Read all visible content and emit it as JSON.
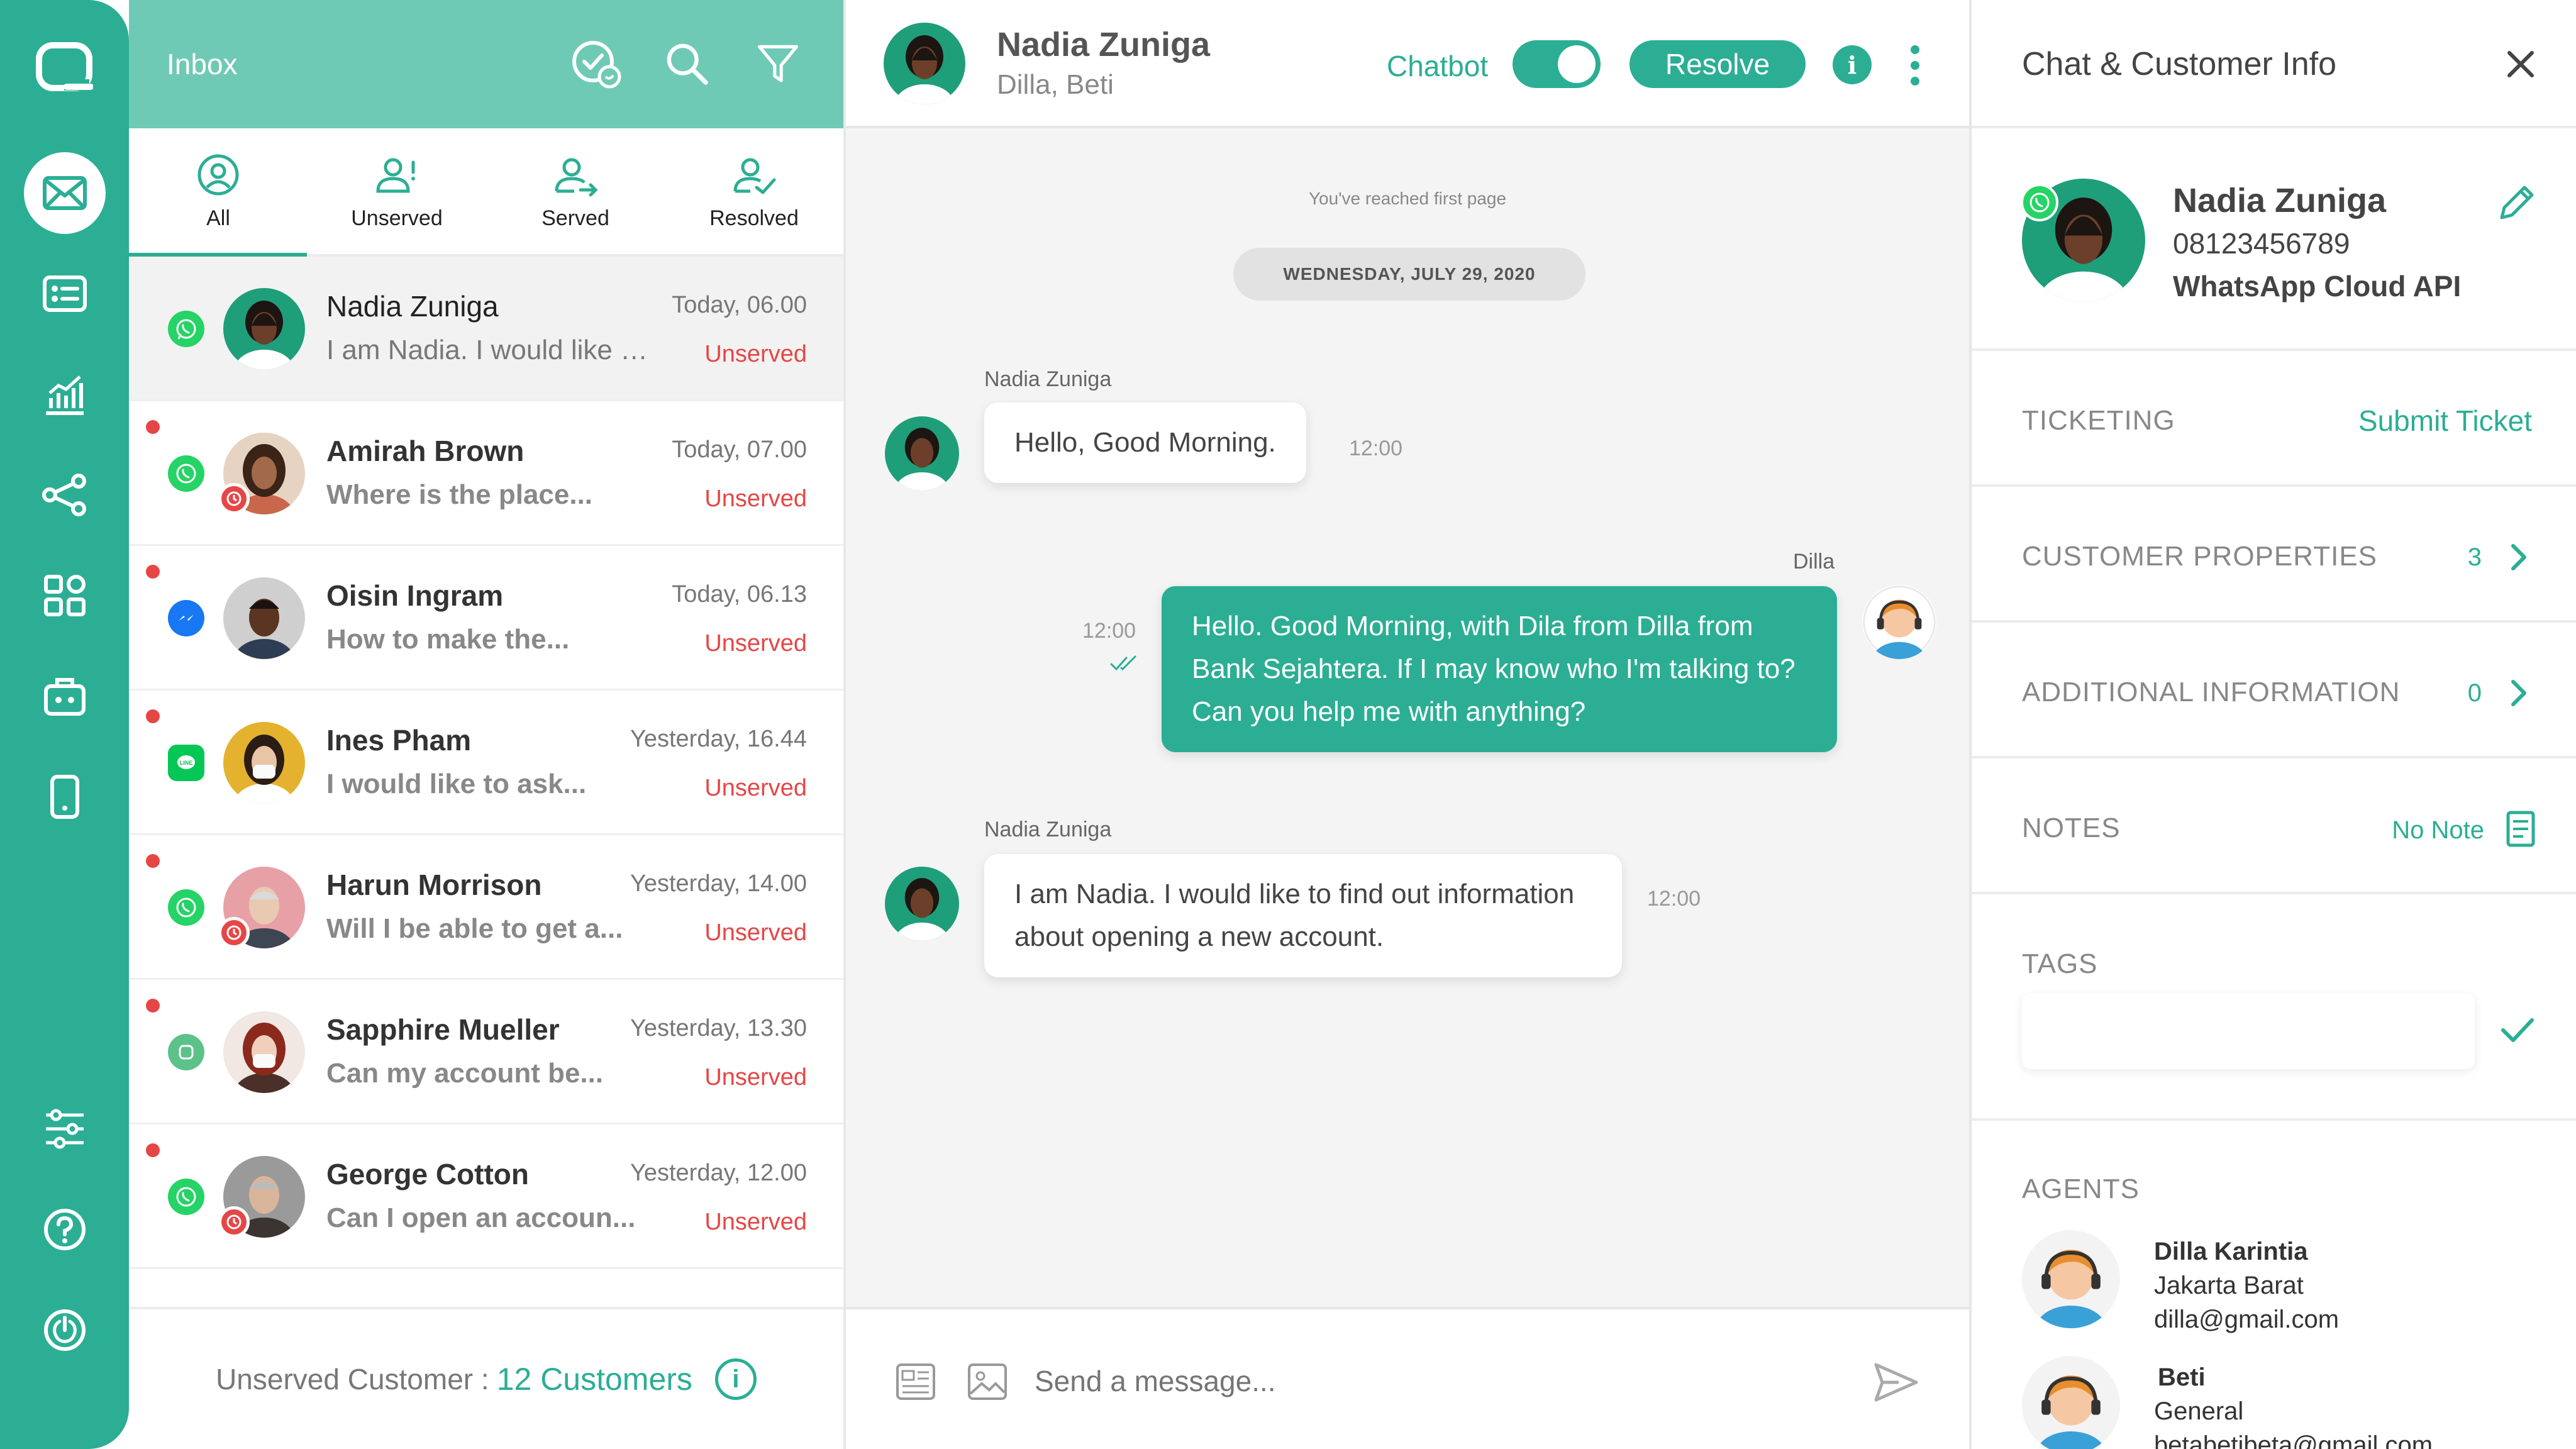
{
  "colors": {
    "primary": "#2bae94",
    "header_light": "#6fcab5",
    "alert": "#e64646"
  },
  "rail": {
    "items": [
      {
        "icon": "logo-icon"
      },
      {
        "icon": "inbox-mail-icon",
        "active": true
      },
      {
        "icon": "contact-card-icon"
      },
      {
        "icon": "analytics-icon"
      },
      {
        "icon": "share-network-icon"
      },
      {
        "icon": "apps-grid-icon"
      },
      {
        "icon": "bot-icon"
      },
      {
        "icon": "mobile-device-icon"
      },
      {
        "icon": "settings-sliders-icon"
      },
      {
        "icon": "help-icon"
      },
      {
        "icon": "power-icon"
      }
    ]
  },
  "inbox": {
    "title": "Inbox",
    "tabs": [
      {
        "label": "All",
        "icon": "user-circle-icon",
        "active": true
      },
      {
        "label": "Unserved",
        "icon": "user-alert-icon"
      },
      {
        "label": "Served",
        "icon": "user-arrow-icon"
      },
      {
        "label": "Resolved",
        "icon": "user-check-icon"
      }
    ],
    "conversations": [
      {
        "name": "Nadia Zuniga",
        "time": "Today, 06.00",
        "preview": "I am Nadia. I would like to find out information about opening a new account.",
        "status": "Unserved",
        "channel": "whatsapp",
        "unread": false,
        "selected": true,
        "overdue": false
      },
      {
        "name": "Amirah Brown",
        "time": "Today, 07.00",
        "preview": "Where is the place...",
        "status": "Unserved",
        "channel": "whatsapp",
        "unread": true,
        "overdue": true
      },
      {
        "name": "Oisin Ingram",
        "time": "Today, 06.13",
        "preview": "How to make the...",
        "status": "Unserved",
        "channel": "messenger",
        "unread": true,
        "overdue": false
      },
      {
        "name": "Ines Pham",
        "time": "Yesterday, 16.44",
        "preview": "I would like to ask...",
        "status": "Unserved",
        "channel": "line",
        "unread": true,
        "overdue": false
      },
      {
        "name": "Harun Morrison",
        "time": "Yesterday, 14.00",
        "preview": "Will I be able to get a...",
        "status": "Unserved",
        "channel": "whatsapp",
        "unread": true,
        "overdue": true
      },
      {
        "name": "Sapphire Mueller",
        "time": "Yesterday, 13.30",
        "preview": "Can my account be...",
        "status": "Unserved",
        "channel": "chat",
        "unread": true,
        "overdue": false
      },
      {
        "name": "George  Cotton",
        "time": "Yesterday, 12.00",
        "preview": "Can I open an accoun...",
        "status": "Unserved",
        "channel": "whatsapp",
        "unread": true,
        "overdue": true
      }
    ],
    "footer": {
      "label": "Unserved Customer :",
      "count": "12 Customers"
    }
  },
  "chat": {
    "contact_name": "Nadia Zuniga",
    "agents_line": "Dilla, Beti",
    "chatbot_label": "Chatbot",
    "chatbot_on": true,
    "resolve_label": "Resolve",
    "first_page_note": "You've reached first page",
    "date_divider": "WEDNESDAY, JULY 29, 2020",
    "messages": [
      {
        "sender": "Nadia Zuniga",
        "text": "Hello, Good Morning.",
        "time": "12:00",
        "direction": "in"
      },
      {
        "sender": "Dilla",
        "text": "Hello. Good Morning, with Dila from Dilla from Bank Sejahtera. If I may know who I'm talking to? Can you help me with anything?",
        "time": "12:00",
        "direction": "out"
      },
      {
        "sender": "Nadia Zuniga",
        "text": "I am Nadia. I would like to find out information about opening a new account.",
        "time": "12:00",
        "direction": "in"
      }
    ],
    "composer_placeholder": "Send a message..."
  },
  "info": {
    "title": "Chat & Customer Info",
    "customer": {
      "name": "Nadia Zuniga",
      "phone": "08123456789",
      "channel": "WhatsApp Cloud API"
    },
    "ticketing": {
      "label": "TICKETING",
      "action": "Submit Ticket"
    },
    "properties": {
      "label": "CUSTOMER PROPERTIES",
      "count": "3"
    },
    "additional": {
      "label": "ADDITIONAL INFORMATION",
      "count": "0"
    },
    "notes": {
      "label": "NOTES",
      "value": "No Note"
    },
    "tags": {
      "label": "TAGS"
    },
    "agents_label": "AGENTS",
    "agents": [
      {
        "name": "Dilla Karintia",
        "location": "Jakarta Barat",
        "email": "dilla@gmail.com"
      },
      {
        "name": "Beti",
        "location": "General",
        "email": "betabetibeta@gmail.com"
      }
    ]
  }
}
